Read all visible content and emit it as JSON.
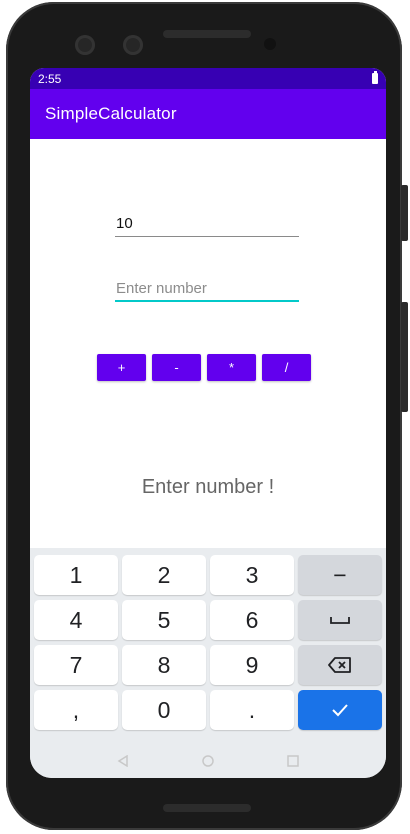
{
  "status_bar": {
    "time": "2:55"
  },
  "app_bar": {
    "title": "SimpleCalculator"
  },
  "inputs": {
    "first_number": {
      "value": "10"
    },
    "second_number": {
      "value": "",
      "placeholder": "Enter number"
    }
  },
  "operations": [
    "+",
    "-",
    "*",
    "/"
  ],
  "result_text": "Enter number !",
  "keyboard": {
    "rows": [
      [
        "1",
        "2",
        "3",
        "−"
      ],
      [
        "4",
        "5",
        "6",
        "␣"
      ],
      [
        "7",
        "8",
        "9",
        "⌫"
      ],
      [
        ",",
        "0",
        ".",
        "✓"
      ]
    ],
    "icons": {
      "space": "space-bar-icon",
      "backspace": "backspace-icon",
      "done": "check-icon"
    }
  },
  "colors": {
    "status_bar": "#3700b3",
    "app_bar": "#6200ee",
    "accent": "#03c9c9",
    "keyboard_action": "#1a73e8"
  }
}
